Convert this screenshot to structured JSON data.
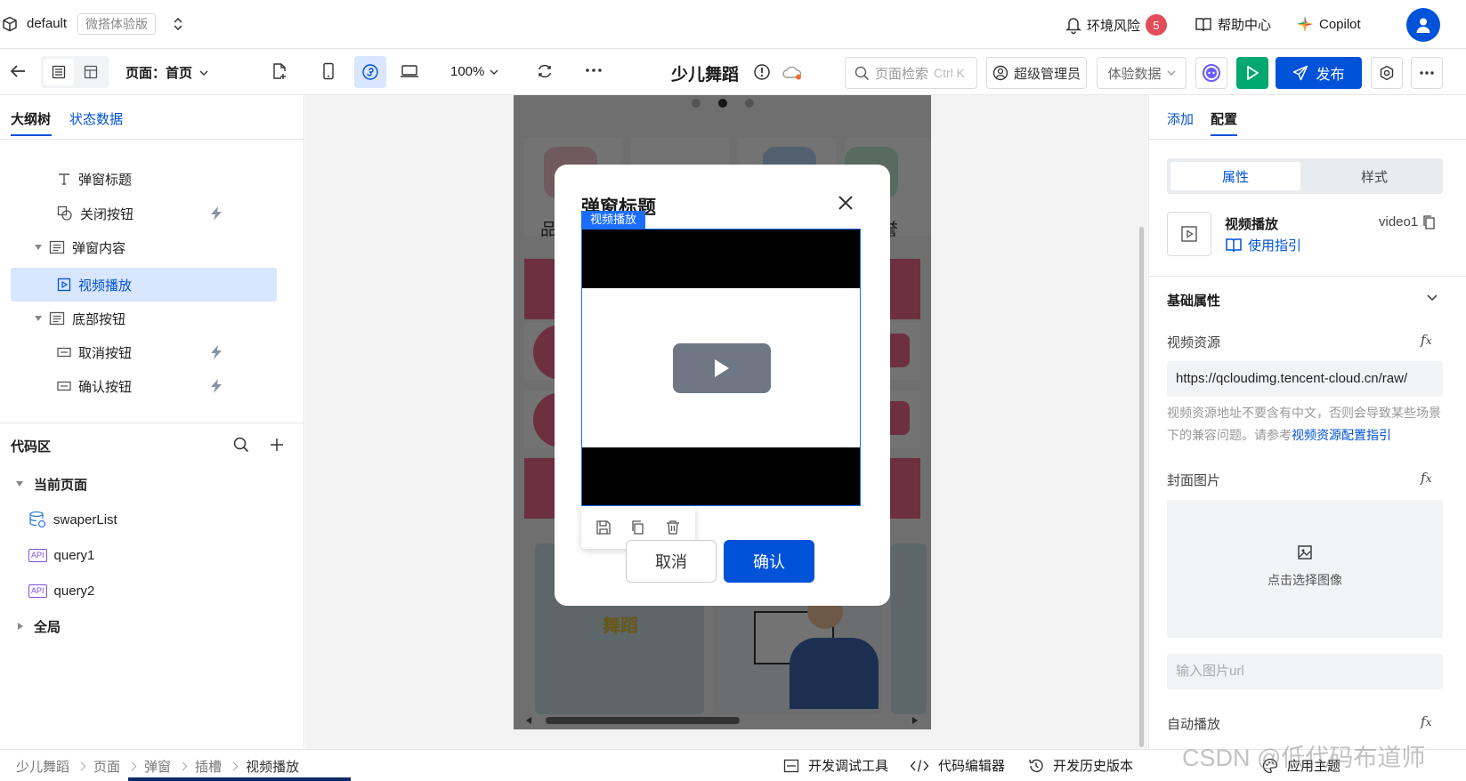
{
  "topbar": {
    "app_name": "default",
    "edition_badge": "微搭体验版",
    "env_risk_label": "环境风险",
    "env_risk_count": "5",
    "help_label": "帮助中心",
    "copilot_label": "Copilot"
  },
  "toolbar": {
    "page_select_label": "页面：首页",
    "zoom": "100%",
    "app_title": "少儿舞蹈",
    "search_placeholder": "页面检索",
    "search_shortcut": "Ctrl K",
    "admin_label": "超级管理员",
    "data_select_label": "体验数据",
    "publish_label": "发布"
  },
  "left_panel": {
    "tabs": [
      "大纲树",
      "状态数据"
    ],
    "tree": [
      {
        "label": "弹窗标题",
        "icon": "text-icon"
      },
      {
        "label": "关闭按钮",
        "icon": "shape-icon"
      },
      {
        "label": "弹窗内容",
        "icon": "container-icon"
      },
      {
        "label": "视频播放",
        "icon": "video-icon"
      },
      {
        "label": "底部按钮",
        "icon": "container-icon"
      },
      {
        "label": "取消按钮",
        "icon": "button-icon"
      },
      {
        "label": "确认按钮",
        "icon": "button-icon"
      }
    ],
    "code_section_title": "代码区",
    "current_page_label": "当前页面",
    "code_items": [
      "swaperList",
      "query1",
      "query2"
    ],
    "api_badge": "API",
    "global_label": "全局"
  },
  "canvas": {
    "modal_title": "弹窗标题",
    "video_tag": "视频播放",
    "cancel_label": "取消",
    "confirm_label": "确认",
    "bg_partial_left": "品",
    "bg_partial_right": "誉",
    "bg_image_text": "舞蹈"
  },
  "right_panel": {
    "tabs": [
      "添加",
      "配置"
    ],
    "seg_tabs": [
      "属性",
      "样式"
    ],
    "component_name": "视频播放",
    "component_id": "video1",
    "guide_link": "使用指引",
    "section_title": "基础属性",
    "video_source_label": "视频资源",
    "video_source_value": "https://qcloudimg.tencent-cloud.cn/raw/",
    "hint_text": "视频资源地址不要含有中文，否则会导致某些场景下的兼容问题。请参考",
    "hint_link": "视频资源配置指引",
    "cover_label": "封面图片",
    "cover_upload_text": "点击选择图像",
    "cover_url_placeholder": "输入图片url",
    "autoplay_label": "自动播放"
  },
  "bottom_bar": {
    "breadcrumb": [
      "少儿舞蹈",
      "页面",
      "弹窗",
      "插槽",
      "视频播放"
    ],
    "dev_tools": "开发调试工具",
    "code_editor": "代码编辑器",
    "history": "开发历史版本",
    "apply_theme": "应用主题",
    "watermark": "CSDN @低代码布道师"
  },
  "colors": {
    "accent": "#0052d9",
    "danger": "#e34d59",
    "green": "#00a870",
    "selected_bg": "#d9e6ff"
  }
}
